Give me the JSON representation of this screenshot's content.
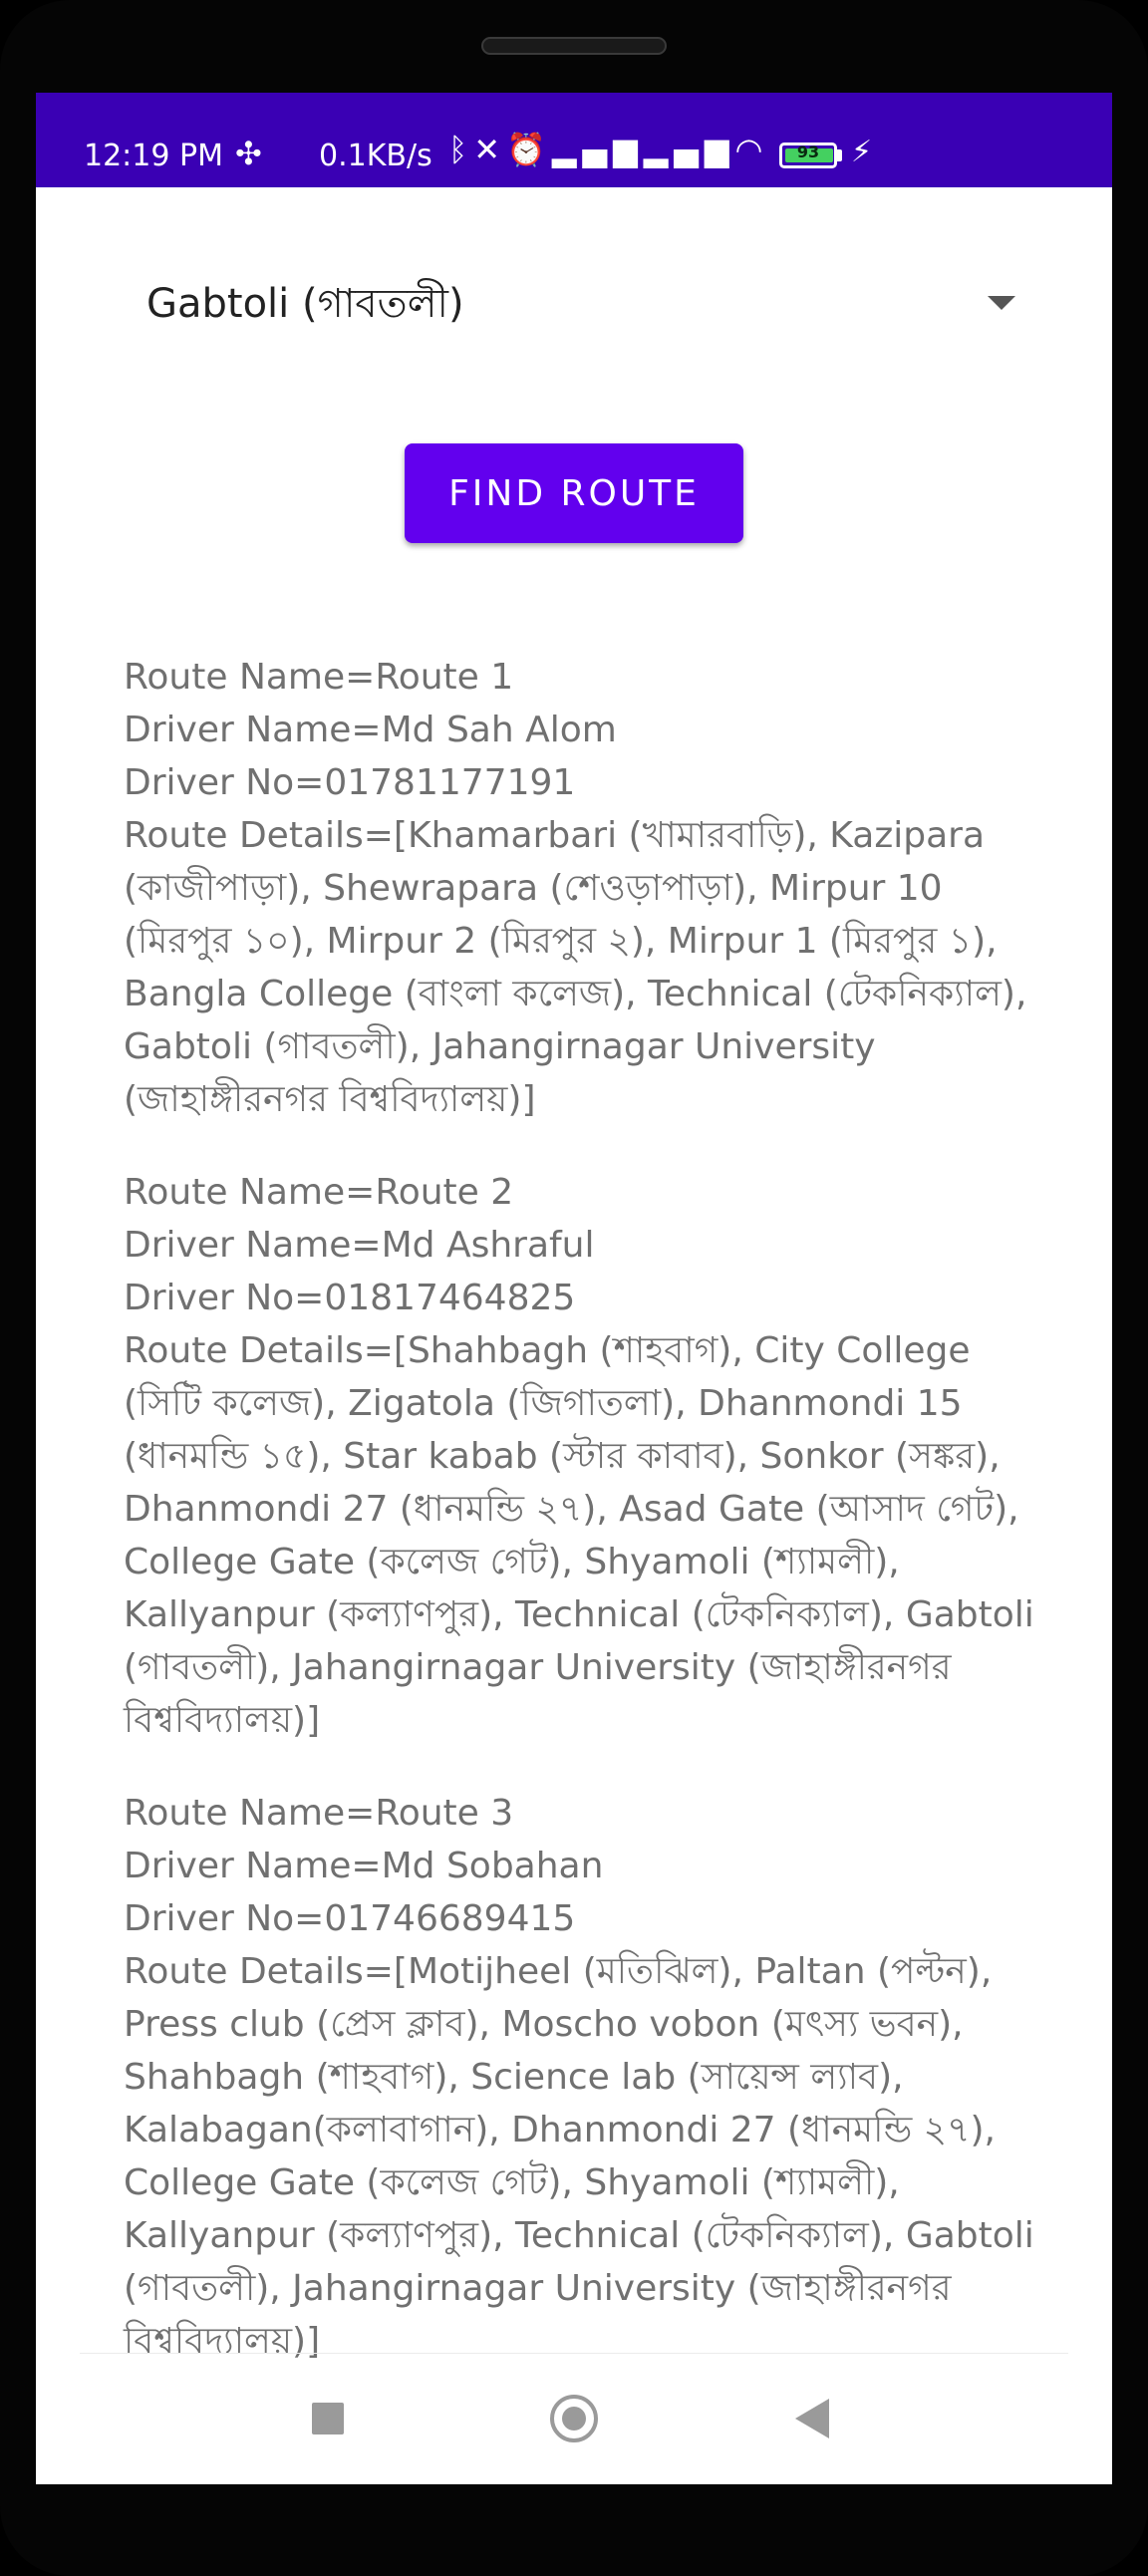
{
  "status_bar": {
    "time": "12:19 PM",
    "network_speed": "0.1KB/s",
    "battery_level": "93",
    "icons": [
      "slack-icon",
      "bluetooth-icon",
      "vibrate-off-icon",
      "alarm-icon",
      "signal-icon",
      "signal-icon",
      "wifi-icon",
      "battery-icon",
      "charging-icon"
    ]
  },
  "spinner": {
    "selected": "Gabtoli (গাবতলী)"
  },
  "find_button": {
    "label": "FIND ROUTE"
  },
  "routes": [
    {
      "name": "Route Name=Route 1",
      "driver": "Driver Name=Md Sah Alom",
      "phone": "Driver No=01781177191",
      "details": "Route Details=[Khamarbari (খামারবাড়ি), Kazipara (কাজীপাড়া), Shewrapara (শেওড়াপাড়া), Mirpur 10 (মিরপুর ১০), Mirpur 2 (মিরপুর ২), Mirpur 1 (মিরপুর ১), Bangla College (বাংলা কলেজ), Technical (টেকনিক্যাল), Gabtoli (গাবতলী), Jahangirnagar University (জাহাঙ্গীরনগর বিশ্ববিদ্যালয়)]"
    },
    {
      "name": "Route Name=Route 2",
      "driver": "Driver Name=Md Ashraful",
      "phone": "Driver No=01817464825",
      "details": "Route Details=[Shahbagh (শাহবাগ), City College (সিটি কলেজ), Zigatola (জিগাতলা), Dhanmondi 15 (ধানমন্ডি ১৫), Star kabab (স্টার কাবাব), Sonkor (সঙ্কর), Dhanmondi 27 (ধানমন্ডি ২৭), Asad Gate (আসাদ গেট), College Gate (কলেজ গেট), Shyamoli (শ্যামলী), Kallyanpur (কল্যাণপুর), Technical (টেকনিক্যাল), Gabtoli (গাবতলী), Jahangirnagar University (জাহাঙ্গীরনগর বিশ্ববিদ্যালয়)]"
    },
    {
      "name": "Route Name=Route 3",
      "driver": "Driver Name=Md Sobahan",
      "phone": "Driver No=01746689415",
      "details": "Route Details=[Motijheel (মতিঝিল), Paltan (পল্টন), Press club (প্রেস ক্লাব), Moscho vobon (মৎস্য ভবন), Shahbagh (শাহবাগ), Science lab (সায়েন্স ল্যাব), Kalabagan(কলাবাগান), Dhanmondi 27 (ধানমন্ডি ২৭), College Gate (কলেজ গেট), Shyamoli (শ্যামলী), Kallyanpur (কল্যাণপুর), Technical (টেকনিক্যাল), Gabtoli (গাবতলী), Jahangirnagar University (জাহাঙ্গীরনগর বিশ্ববিদ্যালয়)]"
    }
  ],
  "navbar": {
    "icons": [
      "recents-icon",
      "home-icon",
      "back-icon"
    ]
  }
}
